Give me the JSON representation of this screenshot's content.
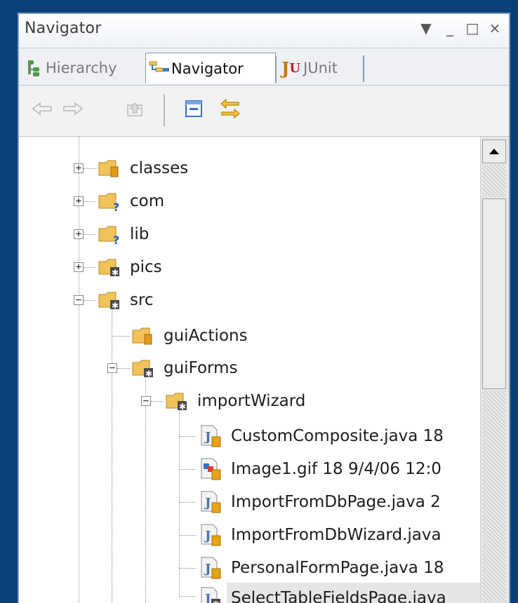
{
  "window": {
    "title": "Navigator",
    "controls": {
      "menu": "▼",
      "minimize": "_",
      "maximize": "□",
      "close": "×"
    }
  },
  "tabs": [
    {
      "label": "Hierarchy",
      "icon": "hierarchy-icon",
      "active": false
    },
    {
      "label": "Navigator",
      "icon": "navigator-icon",
      "active": true
    },
    {
      "label": "JUnit",
      "icon": "junit-icon",
      "active": false
    }
  ],
  "toolbar": [
    {
      "name": "back-icon",
      "enabled": false
    },
    {
      "name": "forward-icon",
      "enabled": false
    },
    {
      "name": "up-icon",
      "enabled": false
    },
    {
      "name": "collapse-all-icon",
      "enabled": true
    },
    {
      "name": "link-with-editor-icon",
      "enabled": true
    }
  ],
  "tree": {
    "rows": [
      {
        "label": "classes",
        "icon": "folder-library-icon",
        "expander": "+",
        "level": 0
      },
      {
        "label": "com",
        "icon": "folder-unknown-icon",
        "expander": "+",
        "level": 0
      },
      {
        "label": "lib",
        "icon": "folder-unknown-icon",
        "expander": "+",
        "level": 0
      },
      {
        "label": "pics",
        "icon": "folder-source-icon",
        "expander": "+",
        "level": 0
      },
      {
        "label": "src",
        "icon": "folder-source-icon",
        "expander": "−",
        "level": 0
      },
      {
        "label": "guiActions",
        "icon": "folder-library-icon",
        "expander": "",
        "level": 1
      },
      {
        "label": "guiForms",
        "icon": "folder-source-icon",
        "expander": "−",
        "level": 1
      },
      {
        "label": "importWizard",
        "icon": "folder-source-icon",
        "expander": "−",
        "level": 2
      },
      {
        "label": "CustomComposite.java 18",
        "icon": "java-file-icon",
        "expander": "",
        "level": 3
      },
      {
        "label": "Image1.gif 18  9/4/06 12:0",
        "icon": "gif-file-icon",
        "expander": "",
        "level": 3
      },
      {
        "label": "ImportFromDbPage.java 2",
        "icon": "java-file-icon",
        "expander": "",
        "level": 3
      },
      {
        "label": "ImportFromDbWizard.java",
        "icon": "java-file-icon",
        "expander": "",
        "level": 3
      },
      {
        "label": "PersonalFormPage.java 18",
        "icon": "java-file-icon",
        "expander": "",
        "level": 3
      },
      {
        "label": "SelectTableFieldsPage.java",
        "icon": "java-file-icon",
        "expander": "",
        "level": 3,
        "selected": true
      }
    ]
  },
  "colors": {
    "desktop": "#0a3f7a",
    "folder": "#f2c35b",
    "java_badge": "#e8a318",
    "java_letter": "#4a6fb5"
  }
}
